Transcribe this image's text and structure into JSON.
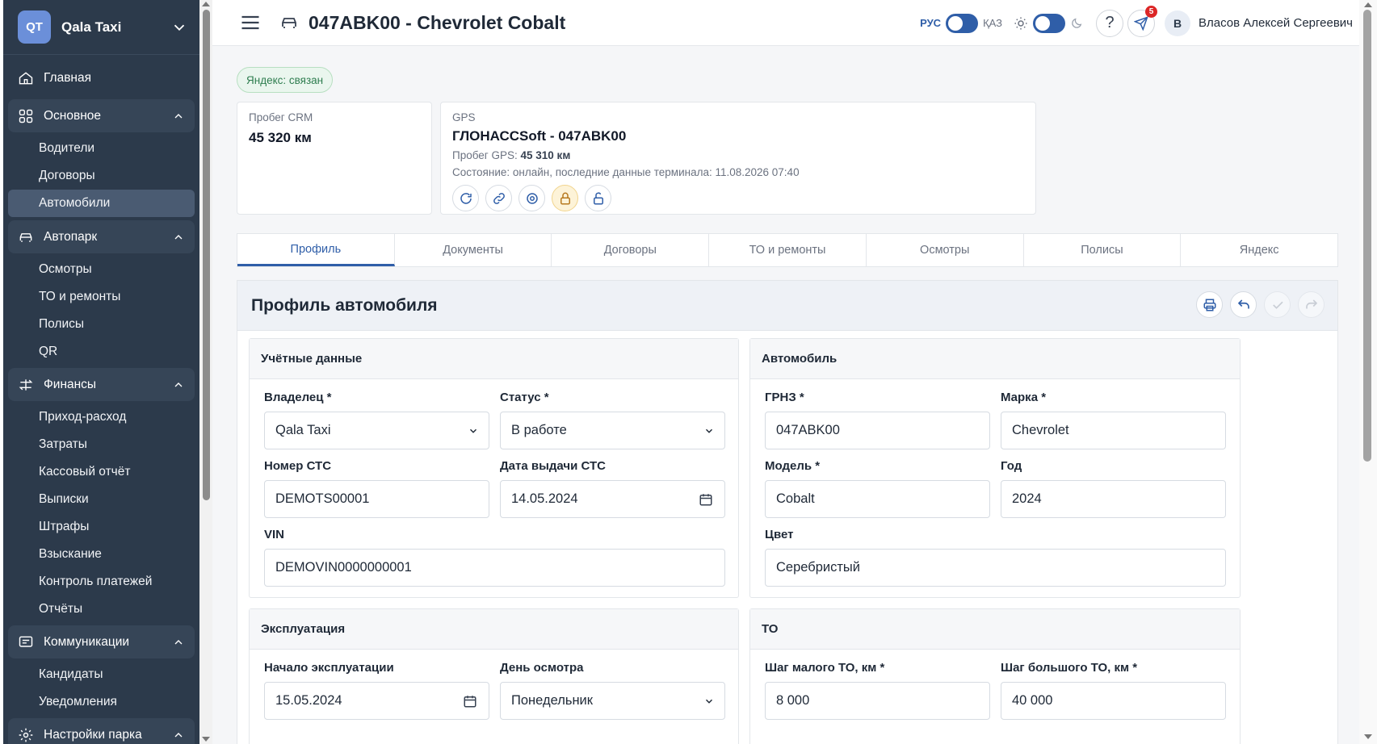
{
  "app": {
    "logo": "QT",
    "org_name": "Qala Taxi"
  },
  "sidebar": {
    "items": [
      {
        "label": "Главная",
        "icon": "home-icon"
      },
      {
        "label": "Основное",
        "icon": "grid-icon",
        "children": [
          "Водители",
          "Договоры",
          "Автомобили"
        ]
      },
      {
        "label": "Автопарк",
        "icon": "car-icon",
        "children": [
          "Осмотры",
          "ТО и ремонты",
          "Полисы",
          "QR"
        ]
      },
      {
        "label": "Финансы",
        "icon": "finance-icon",
        "children": [
          "Приход-расход",
          "Затраты",
          "Кассовый отчёт",
          "Выписки",
          "Штрафы",
          "Взыскание",
          "Контроль платежей",
          "Отчёты"
        ]
      },
      {
        "label": "Коммуникации",
        "icon": "message-icon",
        "children": [
          "Кандидаты",
          "Уведомления"
        ]
      },
      {
        "label": "Настройки парка",
        "icon": "gear-icon"
      }
    ],
    "active": "Автомобили"
  },
  "header": {
    "title": "047ABK00 - Chevrolet Cobalt",
    "lang_ru": "РУС",
    "lang_kz": "ҚАЗ",
    "notifications": "5",
    "user_initial": "В",
    "user_name": "Власов Алексей Сергеевич"
  },
  "yandex_status": "Яндекс: связан",
  "crm": {
    "label": "Пробег CRM",
    "value": "45 320 км"
  },
  "gps": {
    "label": "GPS",
    "title": "ГЛОНАССSoft - 047ABK00",
    "mileage_label": "Пробег GPS:",
    "mileage_value": "45 310 км",
    "state": "Состояние: онлайн, последние данные терминала: 11.08.2026 07:40"
  },
  "tabs": [
    "Профиль",
    "Документы",
    "Договоры",
    "ТО и ремонты",
    "Осмотры",
    "Полисы",
    "Яндекс"
  ],
  "profile": {
    "title": "Профиль автомобиля",
    "accounting": {
      "title": "Учётные данные",
      "owner_label": "Владелец *",
      "owner": "Qala Taxi",
      "status_label": "Статус *",
      "status": "В работе",
      "sts_label": "Номер СТС",
      "sts": "DEMOTS00001",
      "sts_date_label": "Дата выдачи СТС",
      "sts_date": "14.05.2024",
      "vin_label": "VIN",
      "vin": "DEMOVIN0000000001"
    },
    "car": {
      "title": "Автомобиль",
      "plate_label": "ГРНЗ *",
      "plate": "047ABK00",
      "brand_label": "Марка *",
      "brand": "Chevrolet",
      "model_label": "Модель *",
      "model": "Cobalt",
      "year_label": "Год",
      "year": "2024",
      "color_label": "Цвет",
      "color": "Серебристый"
    },
    "operation": {
      "title": "Эксплуатация",
      "start_label": "Начало эксплуатации",
      "start": "15.05.2024",
      "day_label": "День осмотра",
      "day": "Понедельник"
    },
    "to": {
      "title": "ТО",
      "small_label": "Шаг малого ТО, км *",
      "small": "8 000",
      "big_label": "Шаг большого ТО, км *",
      "big": "40 000"
    }
  },
  "colors": {
    "sidebar_bg": "#2c3a4b",
    "accent": "#2f5ea8",
    "success": "#2e7d4f",
    "warning_bg": "#fdf3d8"
  }
}
